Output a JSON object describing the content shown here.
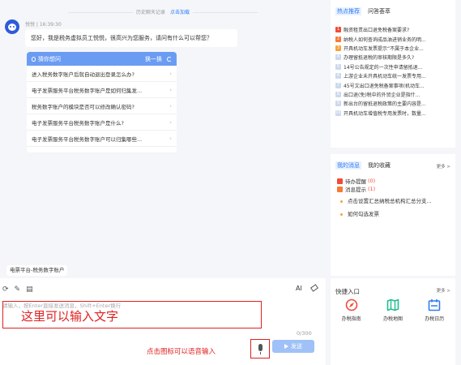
{
  "chat": {
    "history_label": "历史聊天记录",
    "load_more": "点击加载",
    "bot_meta": "悦悦 | 16:39:30",
    "greeting": "您好，我是税务虚拟员工悦悦，很高兴为您服务，请问有什么可以帮您？",
    "card": {
      "title": "猜你想问",
      "switch_label": "换一换",
      "questions": [
        "进入税务数字账户后就自动退出登录怎么办?",
        "电子发票服务平台税务数字账户是如何归集发...",
        "税务数字账户的模块是否可以修改确认密码?",
        "电子发票服务平台税务数字账户是什么?",
        "电子发票服务平台税务数字账户可以归集哪些..."
      ]
    },
    "context_pill": "电票平台-税务数字账户"
  },
  "editor": {
    "tools": [
      "refresh-icon",
      "edit-icon",
      "history-icon"
    ],
    "ai_label": "AI",
    "placeholder": "请输入，按Enter直接发送消息，Shift+Enter换行",
    "annotation_text": "这里可以输入文字",
    "counter": "0/300",
    "voice_hint": "点击图标可以语音输入",
    "send_label": "发送"
  },
  "hot": {
    "tabs": [
      "热点推荐",
      "问答荟萃"
    ],
    "active_tab": 0,
    "items": [
      {
        "rank": "1",
        "text": "融资租赁出口退免税备案要求?"
      },
      {
        "rank": "2",
        "text": "纳税人如何查询成品油进销业务的明..."
      },
      {
        "rank": "3",
        "text": "开具机动车发票提示“不属于本企业..."
      },
      {
        "rank": "4",
        "text": "办理留抵退税的审核期限是多久?"
      },
      {
        "rank": "5",
        "text": "14号公告规定的一次性申请留抵退..."
      },
      {
        "rank": "6",
        "text": "上游企业未开具机动车统一发票专用..."
      },
      {
        "rank": "7",
        "text": "45号文出口退免税备案事项(机动车..."
      },
      {
        "rank": "8",
        "text": "出口退(免)税中的外贸企业是指什..."
      },
      {
        "rank": "9",
        "text": "新出台的留抵退税政策的主要内容是..."
      },
      {
        "rank": "10",
        "text": "开具机动车增值税专用发票时，数量..."
      }
    ]
  },
  "messages": {
    "tabs": [
      "我的消息",
      "我的收藏"
    ],
    "more_label": "更多 >",
    "items": [
      {
        "label": "待办提醒",
        "count": "(0)",
        "color": "#f14b3a"
      },
      {
        "label": "消息提示",
        "count": "(1)",
        "color": "#f77a36"
      }
    ],
    "subitems": [
      "点击设置汇总纳税总机构汇总分支...",
      "如何勾选发票"
    ]
  },
  "quick": {
    "title": "快捷入口",
    "more_label": "更多 >",
    "items": [
      {
        "label": "办税指南",
        "icon": "compass-icon",
        "color": "#f14b3a"
      },
      {
        "label": "办税地图",
        "icon": "map-icon",
        "color": "#1fbf8f"
      },
      {
        "label": "办税日历",
        "icon": "calendar-icon",
        "color": "#2f7cf6"
      }
    ]
  }
}
